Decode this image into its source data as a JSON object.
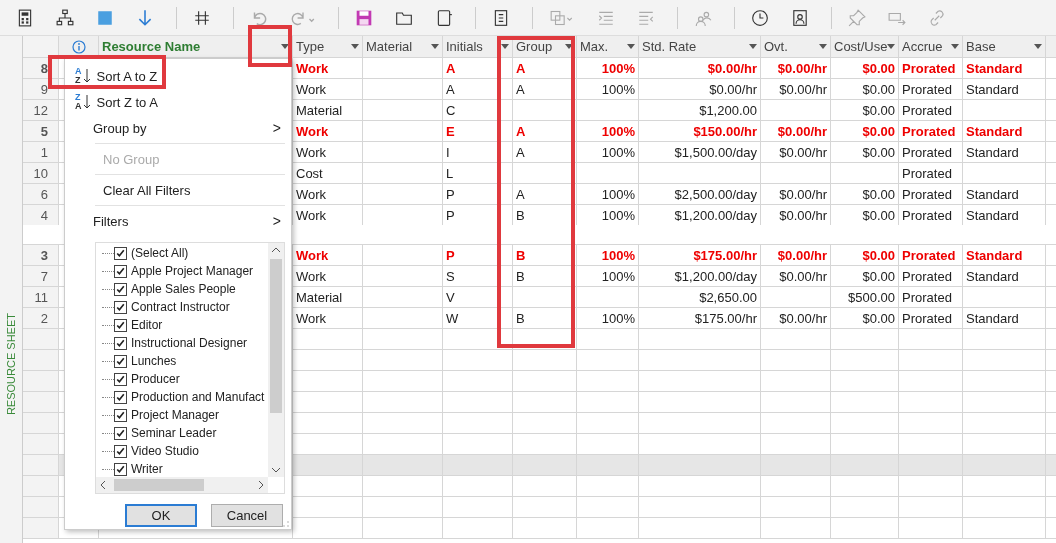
{
  "side_label": "RESOURCE SHEET",
  "columns": [
    {
      "label": "Resource Name",
      "active": true
    },
    {
      "label": "Type",
      "active": false
    },
    {
      "label": "Material",
      "active": false
    },
    {
      "label": "Initials",
      "active": false
    },
    {
      "label": "Group",
      "active": false
    },
    {
      "label": "Max.",
      "active": false
    },
    {
      "label": "Std. Rate",
      "active": false
    },
    {
      "label": "Ovt.",
      "active": false
    },
    {
      "label": "Cost/Use",
      "active": false
    },
    {
      "label": "Accrue",
      "active": false
    },
    {
      "label": "Base",
      "active": false
    }
  ],
  "rows": [
    {
      "id": "8",
      "overallocated": true,
      "tall": false,
      "type": "Work",
      "initials": "A",
      "group": "A",
      "max": "100%",
      "std_rate": "$0.00/hr",
      "ovt": "$0.00/hr",
      "cost_use": "$0.00",
      "accrue": "Prorated",
      "base": "Standard"
    },
    {
      "id": "9",
      "overallocated": false,
      "tall": false,
      "type": "Work",
      "initials": "A",
      "group": "A",
      "max": "100%",
      "std_rate": "$0.00/hr",
      "ovt": "$0.00/hr",
      "cost_use": "$0.00",
      "accrue": "Prorated",
      "base": "Standard"
    },
    {
      "id": "12",
      "overallocated": false,
      "tall": false,
      "type": "Material",
      "initials": "C",
      "std_rate": "$1,200.00",
      "cost_use": "$0.00",
      "accrue": "Prorated"
    },
    {
      "id": "5",
      "overallocated": true,
      "tall": false,
      "type": "Work",
      "initials": "E",
      "group": "A",
      "max": "100%",
      "std_rate": "$150.00/hr",
      "ovt": "$0.00/hr",
      "cost_use": "$0.00",
      "accrue": "Prorated",
      "base": "Standard"
    },
    {
      "id": "1",
      "overallocated": false,
      "tall": false,
      "type": "Work",
      "initials": "I",
      "group": "A",
      "max": "100%",
      "std_rate": "$1,500.00/day",
      "ovt": "$0.00/hr",
      "cost_use": "$0.00",
      "accrue": "Prorated",
      "base": "Standard"
    },
    {
      "id": "10",
      "overallocated": false,
      "tall": false,
      "type": "Cost",
      "initials": "L",
      "accrue": "Prorated"
    },
    {
      "id": "6",
      "overallocated": false,
      "tall": false,
      "type": "Work",
      "initials": "P",
      "group": "A",
      "max": "100%",
      "std_rate": "$2,500.00/day",
      "ovt": "$0.00/hr",
      "cost_use": "$0.00",
      "accrue": "Prorated",
      "base": "Standard"
    },
    {
      "id": "4",
      "overallocated": false,
      "tall": true,
      "type": "Work",
      "initials": "P",
      "group": "B",
      "max": "100%",
      "std_rate": "$1,200.00/day",
      "ovt": "$0.00/hr",
      "cost_use": "$0.00",
      "accrue": "Prorated",
      "base": "Standard"
    },
    {
      "id": "3",
      "overallocated": true,
      "tall": false,
      "type": "Work",
      "initials": "P",
      "group": "B",
      "max": "100%",
      "std_rate": "$175.00/hr",
      "ovt": "$0.00/hr",
      "cost_use": "$0.00",
      "accrue": "Prorated",
      "base": "Standard"
    },
    {
      "id": "7",
      "overallocated": false,
      "tall": false,
      "type": "Work",
      "initials": "S",
      "group": "B",
      "max": "100%",
      "std_rate": "$1,200.00/day",
      "ovt": "$0.00/hr",
      "cost_use": "$0.00",
      "accrue": "Prorated",
      "base": "Standard"
    },
    {
      "id": "11",
      "overallocated": false,
      "tall": false,
      "type": "Material",
      "initials": "V",
      "std_rate": "$2,650.00",
      "cost_use": "$500.00",
      "accrue": "Prorated"
    },
    {
      "id": "2",
      "overallocated": false,
      "tall": false,
      "type": "Work",
      "initials": "W",
      "group": "B",
      "max": "100%",
      "std_rate": "$175.00/hr",
      "ovt": "$0.00/hr",
      "cost_use": "$0.00",
      "accrue": "Prorated",
      "base": "Standard"
    }
  ],
  "menu": {
    "items": [
      {
        "kind": "sort",
        "label": "Sort A to Z",
        "icon_letters": [
          "A",
          "Z"
        ],
        "disabled": false
      },
      {
        "kind": "sort",
        "label": "Sort Z to A",
        "icon_letters": [
          "Z",
          "A"
        ],
        "disabled": false
      },
      {
        "kind": "submenu",
        "label": "Group by",
        "arrow": ">",
        "disabled": false
      },
      {
        "kind": "action",
        "label": "No Group",
        "disabled": true
      },
      {
        "kind": "action",
        "label": "Clear All Filters",
        "disabled": false
      },
      {
        "kind": "submenu",
        "label": "Filters",
        "arrow": ">",
        "disabled": false
      }
    ],
    "filters": [
      {
        "label": "(Select All)",
        "checked": true
      },
      {
        "label": "Apple Project Manager",
        "checked": true
      },
      {
        "label": "Apple Sales People",
        "checked": true
      },
      {
        "label": "Contract Instructor",
        "checked": true
      },
      {
        "label": "Editor",
        "checked": true
      },
      {
        "label": "Instructional Designer",
        "checked": true
      },
      {
        "label": "Lunches",
        "checked": true
      },
      {
        "label": "Producer",
        "checked": true
      },
      {
        "label": "Production and Manufact",
        "checked": true
      },
      {
        "label": "Project Manager",
        "checked": true
      },
      {
        "label": "Seminar Leader",
        "checked": true
      },
      {
        "label": "Video Studio",
        "checked": true
      },
      {
        "label": "Writer",
        "checked": true
      }
    ],
    "buttons": [
      {
        "label": "OK",
        "default": true
      },
      {
        "label": "Cancel",
        "default": false
      }
    ]
  }
}
